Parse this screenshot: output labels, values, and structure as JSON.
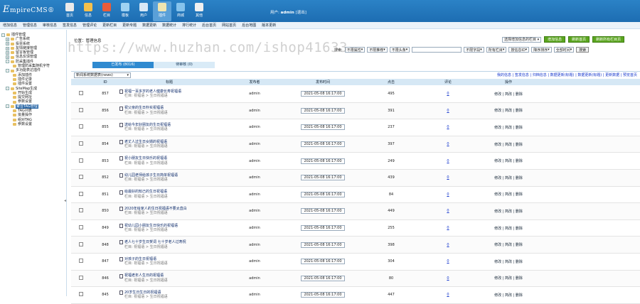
{
  "logo": {
    "main": "E",
    "rest": "mpireCMS",
    "suffix": "®"
  },
  "topnav": [
    {
      "label": "首页",
      "icon": "home-icon",
      "color": "#eaeaea"
    },
    {
      "label": "信息",
      "icon": "info-icon",
      "color": "#f4c04c"
    },
    {
      "label": "栏目",
      "icon": "column-icon",
      "color": "#e85c3a"
    },
    {
      "label": "模板",
      "icon": "template-icon",
      "color": "#9fd2f2"
    },
    {
      "label": "用户",
      "icon": "user-icon",
      "color": "#d8e8f6"
    },
    {
      "label": "插件",
      "icon": "plugin-icon",
      "color": "#f0e5b0"
    },
    {
      "label": "商城",
      "icon": "shop-icon",
      "color": "#86c3ec"
    },
    {
      "label": "其他",
      "icon": "other-icon",
      "color": "#f0f0f0"
    }
  ],
  "user": {
    "prefix": "用户:",
    "name": "admin",
    "logout": "[退出]"
  },
  "subnav": [
    "增加信息",
    "管理信息",
    "审核信息",
    "签发信息",
    "管理评论",
    "更新栏目",
    "更新专题",
    "数据更新",
    "数据统计",
    "排行统计",
    "后台首页",
    "网站首页",
    "后台地图",
    "版本更新"
  ],
  "tree": [
    {
      "level": 0,
      "label": "插件管理",
      "box": "-",
      "sel": false
    },
    {
      "level": 1,
      "label": "广告系统",
      "box": "+",
      "sel": false
    },
    {
      "level": 1,
      "label": "投票系统",
      "box": "+",
      "sel": false
    },
    {
      "level": 1,
      "label": "友情链接管理",
      "box": "+",
      "sel": false
    },
    {
      "level": 1,
      "label": "留言板管理",
      "box": "+",
      "sel": false
    },
    {
      "level": 1,
      "label": "信息反馈管理",
      "box": "+",
      "sel": false
    },
    {
      "level": 1,
      "label": "防采集插件",
      "box": "-",
      "sel": false
    },
    {
      "level": 2,
      "label": "管理防采集随机字符",
      "box": "",
      "sel": false
    },
    {
      "level": 1,
      "label": "多功能表达插件",
      "box": "-",
      "sel": false
    },
    {
      "level": 2,
      "label": "添加插件",
      "box": "",
      "sel": false
    },
    {
      "level": 2,
      "label": "插件记录",
      "box": "",
      "sel": false
    },
    {
      "level": 2,
      "label": "插件设置",
      "box": "",
      "sel": false
    },
    {
      "level": 1,
      "label": "SiteMap生成",
      "box": "-",
      "sel": false
    },
    {
      "level": 2,
      "label": "开始生成",
      "box": "",
      "sel": false
    },
    {
      "level": 2,
      "label": "提交网址",
      "box": "",
      "sel": false
    },
    {
      "level": 2,
      "label": "参数设置",
      "box": "",
      "sel": false
    },
    {
      "level": 1,
      "label": "聚合TAG管理",
      "box": "-",
      "sel": true
    },
    {
      "level": 2,
      "label": "TAG列表",
      "box": "",
      "sel": false
    },
    {
      "level": 2,
      "label": "批量操作",
      "box": "",
      "sel": false
    },
    {
      "level": 2,
      "label": "组对TAG",
      "box": "",
      "sel": false
    },
    {
      "level": 2,
      "label": "参数设置",
      "box": "",
      "sel": false
    }
  ],
  "location": "位置：管理信息",
  "add_select": "选择增加信息的栏目",
  "buttons": [
    "增加信息",
    "刷新首页",
    "刷新所有栏目页"
  ],
  "search": {
    "label": "搜索:",
    "selects": [
      "不限属性",
      "不限推荐",
      "不限头条"
    ],
    "field": "不限字段",
    "column": "所有栏目",
    "sort1": "按信息ID",
    "sort2": "降序排序",
    "time": "全部时间",
    "submit": "搜索"
  },
  "tabs": {
    "published": "已发布 (8016)",
    "draft": "待审核 (0)"
  },
  "data_select": "新闻系统数据表(news)",
  "links": "我的信息 | 签发信息 | 归档信息 | 数据更新(标题) | 数据更新(标题) | 更新数据 | 预览首页",
  "headers": [
    "",
    "ID",
    "标题",
    "发布者",
    "发布时间",
    "点击",
    "评论",
    "操作"
  ],
  "rows": [
    {
      "id": "857",
      "title": "祝福一百多岁的老人健康长寿祝福语",
      "sub": "栏目: 祝福语 > 生日祝福语",
      "author": "admin",
      "time": "2021-05-08 16:17:00",
      "clicks": "495",
      "comments": "0",
      "ops": "修改 | 简改 | 删除"
    },
    {
      "id": "856",
      "title": "祝父亲的生日朴实祝福语",
      "sub": "栏目: 祝福语 > 生日祝福语",
      "author": "admin",
      "time": "2021-05-08 16:17:00",
      "clicks": "391",
      "comments": "0",
      "ops": "修改 | 简改 | 删除"
    },
    {
      "id": "855",
      "title": "送给今年好朋友的生日祝福语",
      "sub": "栏目: 祝福语 > 生日祝福语",
      "author": "admin",
      "time": "2021-05-08 16:17:00",
      "clicks": "237",
      "comments": "0",
      "ops": "修改 | 简改 | 删除"
    },
    {
      "id": "854",
      "title": "老丈人过生日女婿的祝福语",
      "sub": "栏目: 祝福语 > 生日祝福语",
      "author": "admin",
      "time": "2021-05-08 16:17:00",
      "clicks": "397",
      "comments": "0",
      "ops": "修改 | 简改 | 删除"
    },
    {
      "id": "853",
      "title": "祝小朋友生日快乐的祝福语",
      "sub": "栏目: 祝福语 > 生日祝福语",
      "author": "admin",
      "time": "2021-05-08 16:17:00",
      "clicks": "249",
      "comments": "0",
      "ops": "修改 | 简改 | 删除"
    },
    {
      "id": "852",
      "title": "幼儿园老师给孩子生日简单祝福语",
      "sub": "栏目: 祝福语 > 生日祝福语",
      "author": "admin",
      "time": "2021-05-08 16:17:00",
      "clicks": "439",
      "comments": "0",
      "ops": "修改 | 简改 | 删除"
    },
    {
      "id": "851",
      "title": "给最好的知己的生日祝福语",
      "sub": "栏目: 祝福语 > 生日祝福语",
      "author": "admin",
      "time": "2021-05-08 16:17:00",
      "clicks": "84",
      "comments": "0",
      "ops": "修改 | 简改 | 删除"
    },
    {
      "id": "850",
      "title": "2020年给家人的生日祝福语不要太直白",
      "sub": "栏目: 祝福语 > 生日祝福语",
      "author": "admin",
      "time": "2021-05-08 16:17:00",
      "clicks": "449",
      "comments": "0",
      "ops": "修改 | 简改 | 删除"
    },
    {
      "id": "849",
      "title": "祝幼儿园小朋友生日快乐的祝福语",
      "sub": "栏目: 祝福语 > 生日祝福语",
      "author": "admin",
      "time": "2021-05-08 16:17:00",
      "clicks": "255",
      "comments": "0",
      "ops": "修改 | 简改 | 删除"
    },
    {
      "id": "848",
      "title": "老人七十岁生日贺词 七十岁老人过寿祝",
      "sub": "栏目: 祝福语 > 生日祝福语",
      "author": "admin",
      "time": "2021-05-08 16:17:00",
      "clicks": "398",
      "comments": "0",
      "ops": "修改 | 简改 | 删除"
    },
    {
      "id": "847",
      "title": "对孩子的生日祝福语",
      "sub": "栏目: 祝福语 > 生日祝福语",
      "author": "admin",
      "time": "2021-05-08 16:17:00",
      "clicks": "304",
      "comments": "0",
      "ops": "修改 | 简改 | 删除"
    },
    {
      "id": "846",
      "title": "祝福老年人生日的祝福语",
      "sub": "栏目: 祝福语 > 生日祝福语",
      "author": "admin",
      "time": "2021-05-08 16:17:00",
      "clicks": "80",
      "comments": "0",
      "ops": "修改 | 简改 | 删除"
    },
    {
      "id": "845",
      "title": "20岁生日生日的祝福语",
      "sub": "栏目: 祝福语 > 生日祝福语",
      "author": "admin",
      "time": "2021-05-08 16:17:00",
      "clicks": "447",
      "comments": "0",
      "ops": "修改 | 简改 | 删除"
    }
  ],
  "watermark": "https://www.huzhan.com/ishop41633"
}
